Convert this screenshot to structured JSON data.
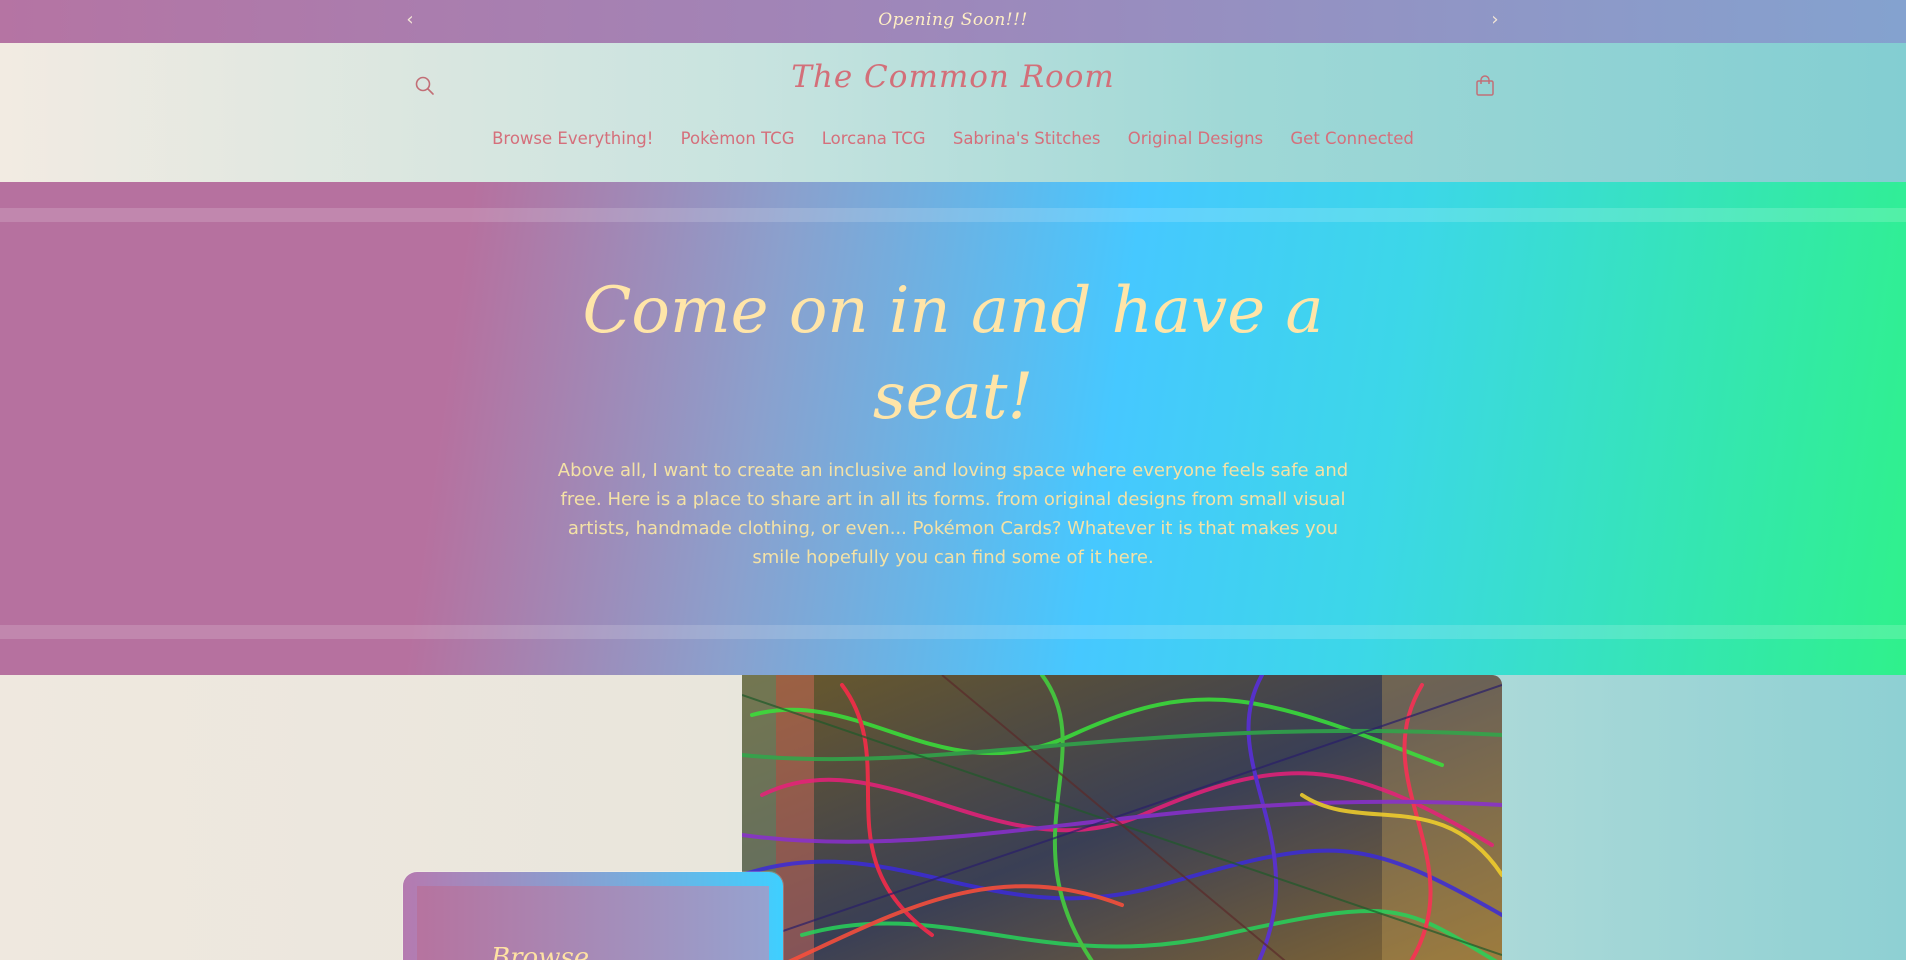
{
  "announcement": {
    "message": "Opening Soon!!!",
    "prev_icon": "‹",
    "next_icon": "›"
  },
  "header": {
    "logo": "The Common Room",
    "search_icon": "search-icon",
    "cart_icon": "bag-icon"
  },
  "nav": {
    "items": [
      {
        "label": "Browse Everything!"
      },
      {
        "label": "Pokèmon TCG"
      },
      {
        "label": "Lorcana TCG"
      },
      {
        "label": "Sabrina's Stitches"
      },
      {
        "label": "Original Designs"
      },
      {
        "label": "Get Connected"
      }
    ]
  },
  "hero": {
    "heading": "Come on in and have a seat!",
    "body": "Above all, I want to create an inclusive and loving space where everyone feels safe and free. Here is a place to share art in all its forms. from original designs from small visual artists, handmade clothing, or even... Pokémon Cards? Whatever it is that makes you smile hopefully you can find some of it here."
  },
  "collection": {
    "card_caption": "Browse"
  },
  "colors": {
    "brand_pink": "#d56f7b",
    "cream_text": "#ffe5a8",
    "hero_gradient": [
      "#b6719f",
      "#46c8ff",
      "#2ff18b"
    ]
  }
}
